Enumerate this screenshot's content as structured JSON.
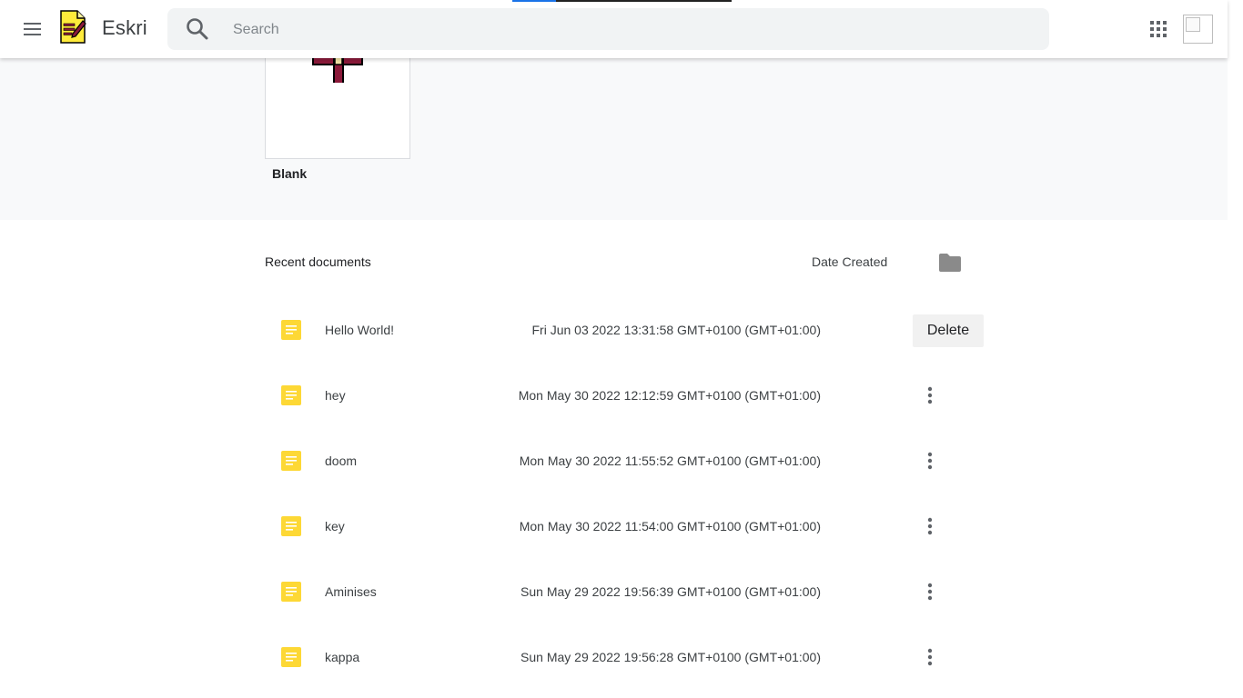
{
  "header": {
    "app_title": "Eskri",
    "menu_icon": "hamburger-menu-icon",
    "logo_icon": "eskri-logo-icon",
    "apps_icon": "apps-grid-icon",
    "avatar_icon": "broken-image-icon"
  },
  "search": {
    "placeholder": "Search",
    "value": "",
    "icon": "search-icon"
  },
  "templates": [
    {
      "name": "Blank",
      "icon": "pen-icon"
    }
  ],
  "recent": {
    "title": "Recent documents",
    "sort_label": "Date Created",
    "folder_icon": "folder-icon",
    "documents": [
      {
        "name": "Hello World!",
        "date": "Fri Jun 03 2022 13:31:58 GMT+0100 (GMT+01:00)",
        "action": "Delete"
      },
      {
        "name": "hey",
        "date": "Mon May 30 2022 12:12:59 GMT+0100 (GMT+01:00)"
      },
      {
        "name": "doom",
        "date": "Mon May 30 2022 11:55:52 GMT+0100 (GMT+01:00)"
      },
      {
        "name": "key",
        "date": "Mon May 30 2022 11:54:00 GMT+0100 (GMT+01:00)"
      },
      {
        "name": "Aminises",
        "date": "Sun May 29 2022 19:56:39 GMT+0100 (GMT+01:00)"
      },
      {
        "name": "kappa",
        "date": "Sun May 29 2022 19:56:28 GMT+0100 (GMT+01:00)"
      }
    ]
  },
  "colors": {
    "doc_icon": "#fdd835",
    "template_bg": "#f8f9fa",
    "search_bg": "#f1f3f4",
    "logo_yellow": "#ffeb3b",
    "pen_maroon": "#8b1a3a"
  }
}
